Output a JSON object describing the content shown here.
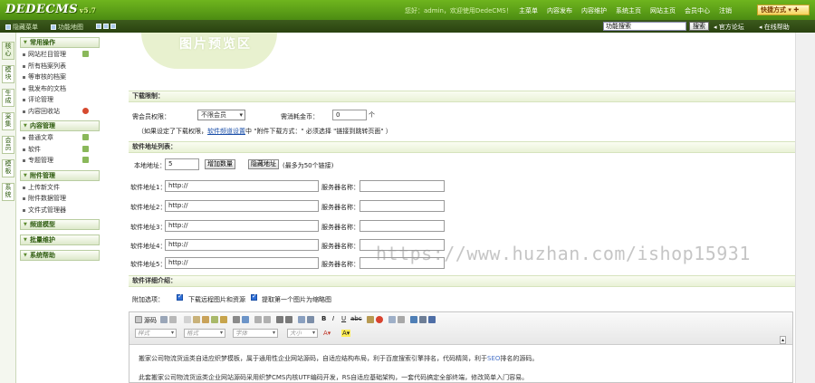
{
  "header": {
    "logo": "DEDECMS",
    "version": "v5.7",
    "welcome": "您好：admin，欢迎使用DedeCMS！",
    "nav": [
      "主菜单",
      "内容发布",
      "内容维护",
      "系统主页",
      "网站主页",
      "会员中心",
      "注销"
    ],
    "quick": "快捷方式"
  },
  "toolbar": {
    "hide_menu": "隐藏菜单",
    "func_map": "功能地图",
    "search_value": "功能搜索",
    "search_button": "搜索",
    "forum": "官方论坛",
    "help": "在线帮助"
  },
  "vtabs": [
    "核心",
    "模块",
    "生成",
    "采集",
    "会员",
    "模板",
    "系统"
  ],
  "menu": {
    "groups": [
      {
        "title": "常用操作",
        "items": [
          "网站栏目管理",
          "所有档案列表",
          "等审核的档案",
          "我发布的文档",
          "评论管理",
          "内容回收站"
        ]
      },
      {
        "title": "内容管理",
        "items": [
          "普通文章",
          "软件",
          "专题管理"
        ]
      },
      {
        "title": "附件管理",
        "items": [
          "上传新文件",
          "附件数据管理",
          "文件式管理器"
        ]
      },
      {
        "title": "频道模型",
        "items": []
      },
      {
        "title": "批量维护",
        "items": []
      },
      {
        "title": "系统帮助",
        "items": []
      }
    ]
  },
  "main": {
    "preview_text": "图片预览区",
    "download_section": "下载限制：",
    "member_level_label": "需会员权限：",
    "member_level_value": "不限会员",
    "coin_label": "需消耗金币：",
    "coin_value": "0",
    "coin_unit": "个",
    "notice_prefix": "（如果设定了下载权限，",
    "notice_link": "软件频道设置",
    "notice_suffix": "中 \"附件下载方式：\" 必须选择 \"链接到跳转页面\" ）",
    "mirrors_section": "软件地址列表：",
    "mirror_count_label": "本地地址：",
    "mirror_count_value": "5",
    "add_count_button": "增加数量",
    "hide_address_button": "隐藏地址",
    "max_hint": "(最多为50个链接)",
    "rows": [
      {
        "label": "软件地址1：",
        "url": "http://",
        "server_label": "服务器名称："
      },
      {
        "label": "软件地址2：",
        "url": "http://",
        "server_label": "服务器名称："
      },
      {
        "label": "软件地址3：",
        "url": "http://",
        "server_label": "服务器名称："
      },
      {
        "label": "软件地址4：",
        "url": "http://",
        "server_label": "服务器名称："
      },
      {
        "label": "软件地址5：",
        "url": "http://",
        "server_label": "服务器名称："
      }
    ],
    "intro_section": "软件详细介绍：",
    "options_label": "附加选项：",
    "option1": "下载远程图片和资源",
    "option2": "提取第一个图片为缩略图"
  },
  "editor": {
    "source_label": "源码",
    "format_selects": [
      "样式",
      "格式",
      "字体",
      "大小"
    ],
    "body_line1_a": "搬家公司物流货运类自适应织梦模板，属于通用性企业网站源码，自适应结构布局，利于百度搜索引擎排名，代码精简，利于",
    "body_line1_hl": "SEO",
    "body_line1_b": "排名的源码。",
    "body_line2": "此套搬家公司物流货运类企业网站源码采用织梦CMS内核UTF编码开发，RS自适应基础架构，一套代码搞定全部终端，修改简单入门容易。"
  },
  "watermark": "https://www.huzhan.com/ishop15931"
}
